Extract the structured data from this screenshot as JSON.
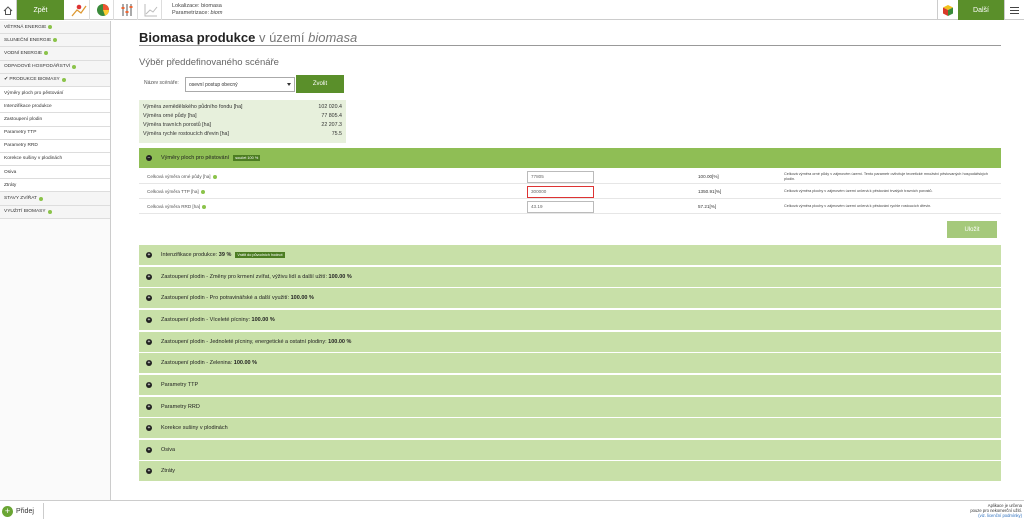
{
  "topbar": {
    "back_label": "Zpět",
    "next_label": "Další",
    "localization_label": "Lokalizace:",
    "localization_value": "biomasa",
    "parametrization_label": "Parametrizace:",
    "parametrization_value": "biom"
  },
  "sidebar": {
    "items": [
      {
        "label": "VĚTRNÁ ENERGIE"
      },
      {
        "label": "SLUNEČNÍ ENERGIE"
      },
      {
        "label": "VODNÍ ENERGIE"
      },
      {
        "label": "ODPADOVÉ HOSPODÁŘSTVÍ"
      },
      {
        "label": "✔ PRODUKCE BIOMASY"
      },
      {
        "label": "Výměry ploch pro pěstování"
      },
      {
        "label": "Intenzifikace produkce"
      },
      {
        "label": "Zastoupení plodin"
      },
      {
        "label": "Parametry TTP"
      },
      {
        "label": "Parametry RRD"
      },
      {
        "label": "Korekce sušiny v plodinách"
      },
      {
        "label": "Osiva"
      },
      {
        "label": "Ztráty"
      },
      {
        "label": "STAVY ZVÍŘAT"
      },
      {
        "label": "VYUŽITÍ BIOMASY"
      }
    ]
  },
  "main": {
    "title_bold": "Biomasa produkce",
    "title_light": "v území",
    "title_italic": "biomasa",
    "subtitle": "Výběr předdefinovaného scénáře",
    "scenario_label": "Název scénáře:",
    "scenario_value": "osevní postup obecný",
    "choose_label": "Zvolit",
    "save_label": "Uložit"
  },
  "stats": [
    {
      "label": "Výměra zemědělského půdního fondu [ha]",
      "value": "102 020.4"
    },
    {
      "label": "Výměra orné půdy [ha]",
      "value": "77 805.4"
    },
    {
      "label": "Výměra travních porostů [ha]",
      "value": "22 207.3"
    },
    {
      "label": "Výměra rychle rostoucích dřevin [ha]",
      "value": "75.5"
    }
  ],
  "open_section": {
    "label": "Výměry ploch pro pěstování",
    "tag": "součet 100 %"
  },
  "params": [
    {
      "label": "Celková výměra orné půdy [ha]",
      "value": "77805",
      "pct": "100.00[%]",
      "desc": "Celková výměra orné půdy v zájmovém území. Tento parametr ovlivňuje teoretické množství pěstovaných hospodářských plodin."
    },
    {
      "label": "Celková výměra TTP [ha]",
      "value": "300000",
      "pct": "1350.91[%]",
      "desc": "Celková výměra plochy v zájmovém území určená k pěstování trvalých travních porostů."
    },
    {
      "label": "Celková výměra RRD [ha]",
      "value": "43.19",
      "pct": "57.21[%]",
      "desc": "Celková výměra plochy v zájmovém území určená k pěstování rychle rostoucích dřevin."
    }
  ],
  "sections": [
    {
      "label": "Intenzifikace produkce:",
      "value": "39 %",
      "tag": "Vrátit do původních hodnot"
    },
    {
      "label": "Zastoupení plodin - Změny pro krmení zvířat, výživu lidí a další užití:",
      "value": "100.00 %",
      "tag": ""
    },
    {
      "label": "Zastoupení plodin - Pro potravinářské a další využití:",
      "value": "100.00 %",
      "tag": ""
    },
    {
      "label": "Zastoupení plodin - Víceleté pícniny:",
      "value": "100.00 %",
      "tag": ""
    },
    {
      "label": "Zastoupení plodin - Jednoleté pícniny, energetické a ostatní plodiny:",
      "value": "100.00 %",
      "tag": ""
    },
    {
      "label": "Zastoupení plodin - Zelenina:",
      "value": "100.00 %",
      "tag": ""
    },
    {
      "label": "Parametry TTP",
      "value": "",
      "tag": ""
    },
    {
      "label": "Parametry RRD",
      "value": "",
      "tag": ""
    },
    {
      "label": "Korekce sušiny v plodinách",
      "value": "",
      "tag": ""
    },
    {
      "label": "Osiva",
      "value": "",
      "tag": ""
    },
    {
      "label": "Ztráty",
      "value": "",
      "tag": ""
    }
  ],
  "bottombar": {
    "add_label": "Přidej",
    "note_line1": "Aplikace je určena",
    "note_line2": "pouze pro nekomerční užití.",
    "note_link": "(viz. licenční podmínky)"
  },
  "colors": {
    "accent": "#5a8f2a",
    "section_bg": "#c8e0a8",
    "section_open": "#8fbe55",
    "stats_bg": "#e7f0dc"
  }
}
